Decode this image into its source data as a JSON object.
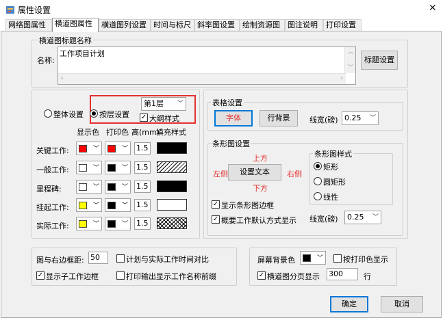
{
  "window": {
    "title": "属性设置",
    "close": "✕"
  },
  "tabs": [
    "网络图属性",
    "横道图属性",
    "横道图列设置",
    "时间与标尺",
    "斜率图设置",
    "绘制资源图",
    "图注说明",
    "打印设置"
  ],
  "title_group": {
    "legend": "横道图标题名称",
    "name_label": "名称:",
    "name_value": "工作项目计划",
    "button": "标题设置"
  },
  "layer": {
    "whole": "整体设置",
    "by_layer": "按层设置",
    "layer_select": "第1层",
    "outline": "大纲样式"
  },
  "columns": {
    "display_color": "显示色",
    "print_color": "打印色",
    "height": "高(mm)",
    "fill": "填充样式"
  },
  "rows": [
    {
      "label": "关键工作:",
      "display": "#ff0000",
      "print": "#ff0000",
      "height": "1.5",
      "fill": "solid"
    },
    {
      "label": "一般工作:",
      "display": "#ffffff",
      "print": "#000000",
      "height": "1.5",
      "fill": "hatch"
    },
    {
      "label": "里程碑:",
      "display": "#ffffff",
      "print": "#000000",
      "height": "1.5",
      "fill": "solid"
    },
    {
      "label": "挂起工作:",
      "display": "#ffff00",
      "print": "#000000",
      "height": "1.5",
      "fill": "empty"
    },
    {
      "label": "实际工作:",
      "display": "#ffff00",
      "print": "#000000",
      "height": "1.5",
      "fill": "cross"
    }
  ],
  "table_group": {
    "legend": "表格设置",
    "font_button": "字体",
    "bg_button": "行背景",
    "line_label": "线宽(磅)",
    "line_value": "0.25"
  },
  "bar_group": {
    "legend": "条形图设置",
    "top": "上方",
    "left": "左侧",
    "right": "右侧",
    "bottom": "下方",
    "text_button": "设置文本",
    "show_border": "显示条形图边框",
    "summary_default": "概要工作默认方式显示",
    "line_label": "线宽(磅)",
    "line_value": "0.25"
  },
  "bar_style": {
    "legend": "条形图样式",
    "options": [
      "矩形",
      "圆矩形",
      "线性"
    ],
    "selected": 0
  },
  "bottom_left": {
    "margin_label": "图与右边框距:",
    "margin_value": "50",
    "plan_compare": "计划与实际工作时间对比",
    "show_sub_border": "显示子工作边框",
    "print_prefix": "打印输出显示工作名称前缀"
  },
  "bottom_right": {
    "screen_bg": "屏幕背景色",
    "print_color_display": "按打印色显示",
    "paging": "横道图分页显示",
    "paging_value": "300",
    "row_unit": "行"
  },
  "actions": {
    "ok": "确定",
    "cancel": "取消"
  }
}
